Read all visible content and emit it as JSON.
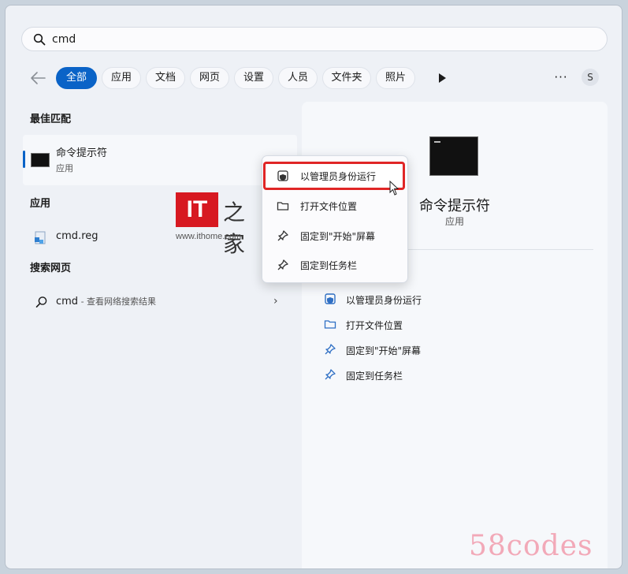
{
  "search": {
    "value": "cmd"
  },
  "filters": {
    "chips": [
      {
        "label": "全部",
        "active": true
      },
      {
        "label": "应用"
      },
      {
        "label": "文档"
      },
      {
        "label": "网页"
      },
      {
        "label": "设置"
      },
      {
        "label": "人员"
      },
      {
        "label": "文件夹"
      },
      {
        "label": "照片"
      }
    ],
    "more_label": "···",
    "avatar": "S"
  },
  "sections": {
    "best_match": "最佳匹配",
    "apps": "应用",
    "web": "搜索网页"
  },
  "best_match": {
    "title": "命令提示符",
    "subtitle": "应用"
  },
  "apps": [
    {
      "label": "cmd.reg"
    }
  ],
  "web": {
    "query": "cmd",
    "hint": " - 查看网络搜索结果",
    "chevron": "›"
  },
  "context_menu": [
    {
      "label": "以管理员身份运行",
      "icon": "shield-icon"
    },
    {
      "label": "打开文件位置",
      "icon": "folder-icon"
    },
    {
      "label": "固定到\"开始\"屏幕",
      "icon": "pin-icon"
    },
    {
      "label": "固定到任务栏",
      "icon": "pin-icon"
    }
  ],
  "detail": {
    "name": "命令提示符",
    "type": "应用",
    "actions": [
      {
        "label": "以管理员身份运行",
        "icon": "shield-icon"
      },
      {
        "label": "打开文件位置",
        "icon": "folder-icon"
      },
      {
        "label": "固定到\"开始\"屏幕",
        "icon": "pin-icon"
      },
      {
        "label": "固定到任务栏",
        "icon": "pin-icon"
      }
    ]
  },
  "watermarks": {
    "it_logo": "IT",
    "it_logo_cn": "之家",
    "it_url": "www.ithome.com",
    "site": "58codes"
  },
  "colors": {
    "accent": "#0a63c7",
    "highlight": "#e02626"
  }
}
